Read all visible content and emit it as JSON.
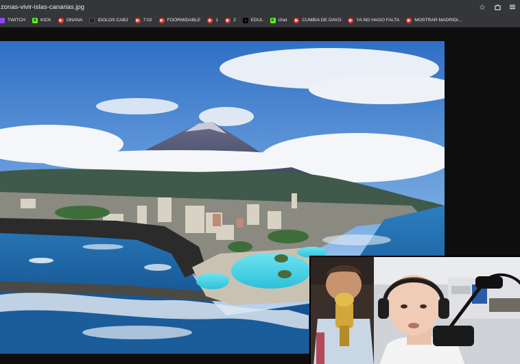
{
  "browser": {
    "url": "zonas-vivir-islas-canarias.jpg",
    "icons": [
      "star-icon",
      "extensions-icon",
      "menu-icon"
    ]
  },
  "bookmarks": [
    {
      "label": "TWITCH",
      "icon": "twitch-icon"
    },
    {
      "label": "KICK",
      "icon": "kick-icon"
    },
    {
      "label": "ONANA",
      "icon": "youtube-icon"
    },
    {
      "label": "IDOLOS CABJ",
      "icon": "idolos-icon"
    },
    {
      "label": "7:02",
      "icon": "youtube-icon"
    },
    {
      "label": "FOORMIDABLE",
      "icon": "youtube-icon"
    },
    {
      "label": "1",
      "icon": "youtube-icon"
    },
    {
      "label": "2",
      "icon": "youtube-icon"
    },
    {
      "label": "EDUL",
      "icon": "tiktok-icon"
    },
    {
      "label": "chat",
      "icon": "kick-icon"
    },
    {
      "label": "CUMBIA DE DAVO",
      "icon": "youtube-icon"
    },
    {
      "label": "YA NO HAGO FALTA",
      "icon": "youtube-icon"
    },
    {
      "label": "MOSTRAR MADRIDI...",
      "icon": "youtube-icon"
    }
  ],
  "colors": {
    "youtube": "#e53935",
    "kick": "#53fc18",
    "twitch": "#9146ff",
    "chrome_bar": "#35363a"
  }
}
